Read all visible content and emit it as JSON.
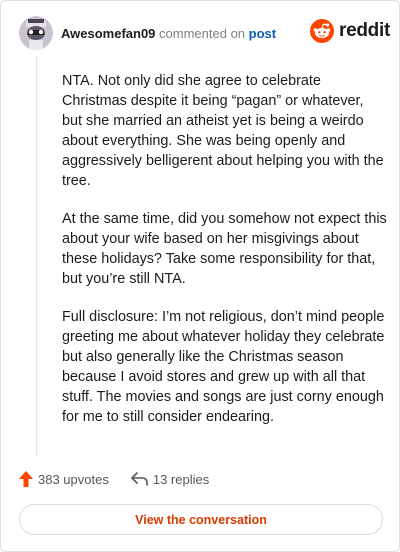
{
  "comment": {
    "username": "Awesomefan09",
    "commented_on_text": "commented on",
    "post_link": "post",
    "paragraphs": [
      "NTA. Not only did she agree to celebrate Christmas despite it being “pagan” or whatever, but she married an atheist yet is being a weirdo about everything. She was being openly and aggressively belligerent about helping you with the tree.",
      "At the same time, did you somehow not expect this about your wife based on her misgivings about these holidays? Take some responsibility for that, but you’re still NTA.",
      "Full disclosure: I’m not religious, don’t mind people greeting me about whatever holiday they celebrate but also generally like the Christmas season because I avoid stores and grew up with all that stuff. The movies and songs are just corny enough for me to still consider endearing."
    ]
  },
  "brand": {
    "wordmark": "reddit",
    "color": "#ff4500"
  },
  "footer": {
    "upvotes": "383 upvotes",
    "replies": "13 replies",
    "view_conversation": "View the conversation"
  },
  "icons": [
    "avatar",
    "reddit-snoo-icon",
    "upvote-arrow-icon",
    "reply-arrow-icon"
  ],
  "colors": {
    "username": "#1c1c1c",
    "meta": "#7c7f83",
    "link": "#0a5eb8",
    "upvote": "#ff4500",
    "button_text": "#d93a00"
  }
}
